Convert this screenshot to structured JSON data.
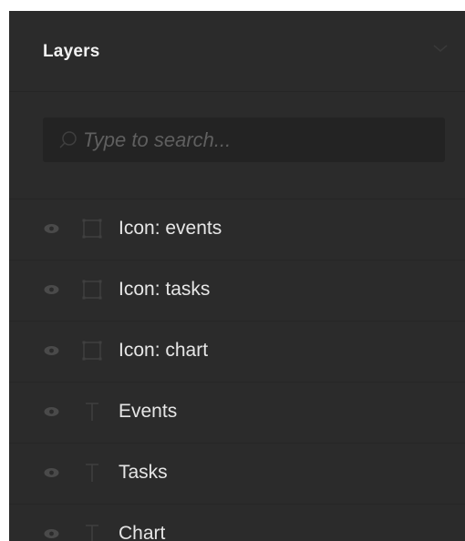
{
  "panel": {
    "title": "Layers",
    "collapse_icon": "chevron-down-icon"
  },
  "search": {
    "placeholder": "Type to search...",
    "value": "",
    "icon": "search-icon"
  },
  "layers": [
    {
      "label": "Icon: events",
      "type": "frame",
      "visible": true
    },
    {
      "label": "Icon: tasks",
      "type": "frame",
      "visible": true
    },
    {
      "label": "Icon: chart",
      "type": "frame",
      "visible": true
    },
    {
      "label": "Events",
      "type": "text",
      "visible": true
    },
    {
      "label": "Tasks",
      "type": "text",
      "visible": true
    },
    {
      "label": "Chart",
      "type": "text",
      "visible": true
    }
  ],
  "colors": {
    "panel_bg": "#2b2b2b",
    "search_bg": "#232323",
    "divider": "#262626",
    "label_text": "#e6e6e6",
    "icon_muted": "#4a4a4a"
  }
}
